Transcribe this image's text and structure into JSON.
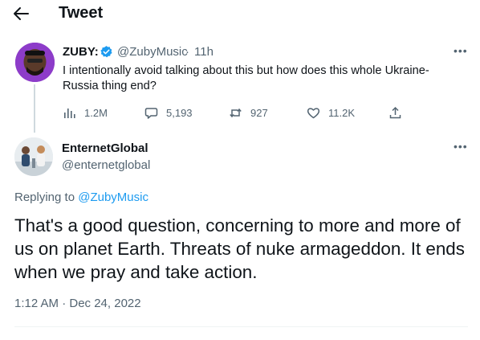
{
  "header": {
    "title": "Tweet"
  },
  "parent": {
    "name": "ZUBY:",
    "handle": "@ZubyMusic",
    "dot": "·",
    "time": "11h",
    "text": "I intentionally avoid talking about this but how does this whole Ukraine-Russia thing end?",
    "more": "•••",
    "stats": {
      "views": "1.2M",
      "replies": "5,193",
      "retweets": "927",
      "likes": "11.2K"
    }
  },
  "reply": {
    "name": "EnternetGlobal",
    "handle": "@enternetglobal",
    "more": "•••",
    "replying_prefix": "Replying to",
    "replying_to": "@ZubyMusic",
    "text": "That's  a good question, concerning to more and more of us on planet Earth. Threats of nuke armageddon. It ends when we pray and take action.",
    "timestamp": "1:12 AM · Dec 24, 2022"
  },
  "colors": {
    "accent": "#1d9bf0",
    "text_primary": "#0f1419",
    "text_secondary": "#536471",
    "avatar_bg": "#8d3cc9"
  },
  "icons": {
    "back": "arrow-left-icon",
    "verified": "verified-badge-icon",
    "views": "bar-chart-icon",
    "replies": "speech-bubble-icon",
    "retweets": "retweet-icon",
    "likes": "heart-icon",
    "share": "share-upload-icon",
    "more": "more-dots-icon"
  }
}
